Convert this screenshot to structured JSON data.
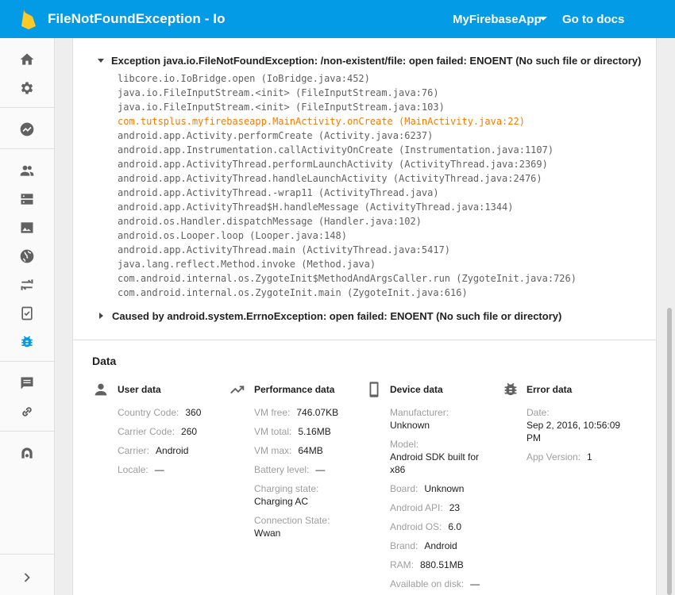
{
  "app": {
    "title": "FileNotFoundException - Io",
    "project_name": "MyFirebaseApp",
    "docs_link": "Go to docs"
  },
  "sidebar": {
    "icons": [
      "home-icon",
      "settings-icon",
      "analytics-icon",
      "users-icon",
      "database-icon",
      "storage-icon",
      "hosting-icon",
      "remote-config-icon",
      "test-lab-icon",
      "crash-reporting-icon",
      "notifications-icon",
      "dynamic-links-icon",
      "admob-icon",
      "expand-icon"
    ],
    "active": "crash-reporting-icon",
    "active_color": "#039be5"
  },
  "exception": {
    "header": "Exception java.io.FileNotFoundException: /non-existent/file: open failed: ENOENT (No such file or directory)",
    "trace": [
      {
        "text": "libcore.io.IoBridge.open (IoBridge.java:452)",
        "highlight": false
      },
      {
        "text": "java.io.FileInputStream.<init> (FileInputStream.java:76)",
        "highlight": false
      },
      {
        "text": "java.io.FileInputStream.<init> (FileInputStream.java:103)",
        "highlight": false
      },
      {
        "text": "com.tutsplus.myfirebaseapp.MainActivity.onCreate (MainActivity.java:22)",
        "highlight": true
      },
      {
        "text": "android.app.Activity.performCreate (Activity.java:6237)",
        "highlight": false
      },
      {
        "text": "android.app.Instrumentation.callActivityOnCreate (Instrumentation.java:1107)",
        "highlight": false
      },
      {
        "text": "android.app.ActivityThread.performLaunchActivity (ActivityThread.java:2369)",
        "highlight": false
      },
      {
        "text": "android.app.ActivityThread.handleLaunchActivity (ActivityThread.java:2476)",
        "highlight": false
      },
      {
        "text": "android.app.ActivityThread.-wrap11 (ActivityThread.java)",
        "highlight": false
      },
      {
        "text": "android.app.ActivityThread$H.handleMessage (ActivityThread.java:1344)",
        "highlight": false
      },
      {
        "text": "android.os.Handler.dispatchMessage (Handler.java:102)",
        "highlight": false
      },
      {
        "text": "android.os.Looper.loop (Looper.java:148)",
        "highlight": false
      },
      {
        "text": "android.app.ActivityThread.main (ActivityThread.java:5417)",
        "highlight": false
      },
      {
        "text": "java.lang.reflect.Method.invoke (Method.java)",
        "highlight": false
      },
      {
        "text": "com.android.internal.os.ZygoteInit$MethodAndArgsCaller.run (ZygoteInit.java:726)",
        "highlight": false
      },
      {
        "text": "com.android.internal.os.ZygoteInit.main (ZygoteInit.java:616)",
        "highlight": false
      }
    ],
    "highlight_color": "#f57c00",
    "caused_by": "Caused by android.system.ErrnoException: open failed: ENOENT (No such file or directory)"
  },
  "data": {
    "heading": "Data",
    "user": {
      "title": "User data",
      "icon": "person-icon",
      "country_code_label": "Country Code:",
      "country_code": "360",
      "carrier_code_label": "Carrier Code:",
      "carrier_code": "260",
      "carrier_label": "Carrier:",
      "carrier": "Android",
      "locale_label": "Locale:",
      "locale": "—"
    },
    "performance": {
      "title": "Performance data",
      "icon": "trending-up-icon",
      "vm_free_label": "VM free:",
      "vm_free": "746.07KB",
      "vm_total_label": "VM total:",
      "vm_total": "5.16MB",
      "vm_max_label": "VM max:",
      "vm_max": "64MB",
      "battery_label": "Battery level:",
      "battery": "—",
      "charging_label": "Charging state:",
      "charging": "Charging AC",
      "connection_label": "Connection State:",
      "connection": "Wwan"
    },
    "device": {
      "title": "Device data",
      "icon": "phone-icon",
      "manufacturer_label": "Manufacturer:",
      "manufacturer": "Unknown",
      "model_label": "Model:",
      "model_line1": "Android SDK built for",
      "model_line2": "x86",
      "board_label": "Board:",
      "board": "Unknown",
      "api_label": "Android API:",
      "api": "23",
      "os_label": "Android OS:",
      "os": "6.0",
      "brand_label": "Brand:",
      "brand": "Android",
      "ram_label": "RAM:",
      "ram": "880.51MB",
      "disk_label": "Available on disk:",
      "disk": "—"
    },
    "error": {
      "title": "Error data",
      "icon": "bug-icon",
      "date_label": "Date:",
      "date_line1": "Sep 2, 2016, 10:56:09",
      "date_line2": "PM",
      "app_version_label": "App Version:",
      "app_version": "1"
    }
  }
}
